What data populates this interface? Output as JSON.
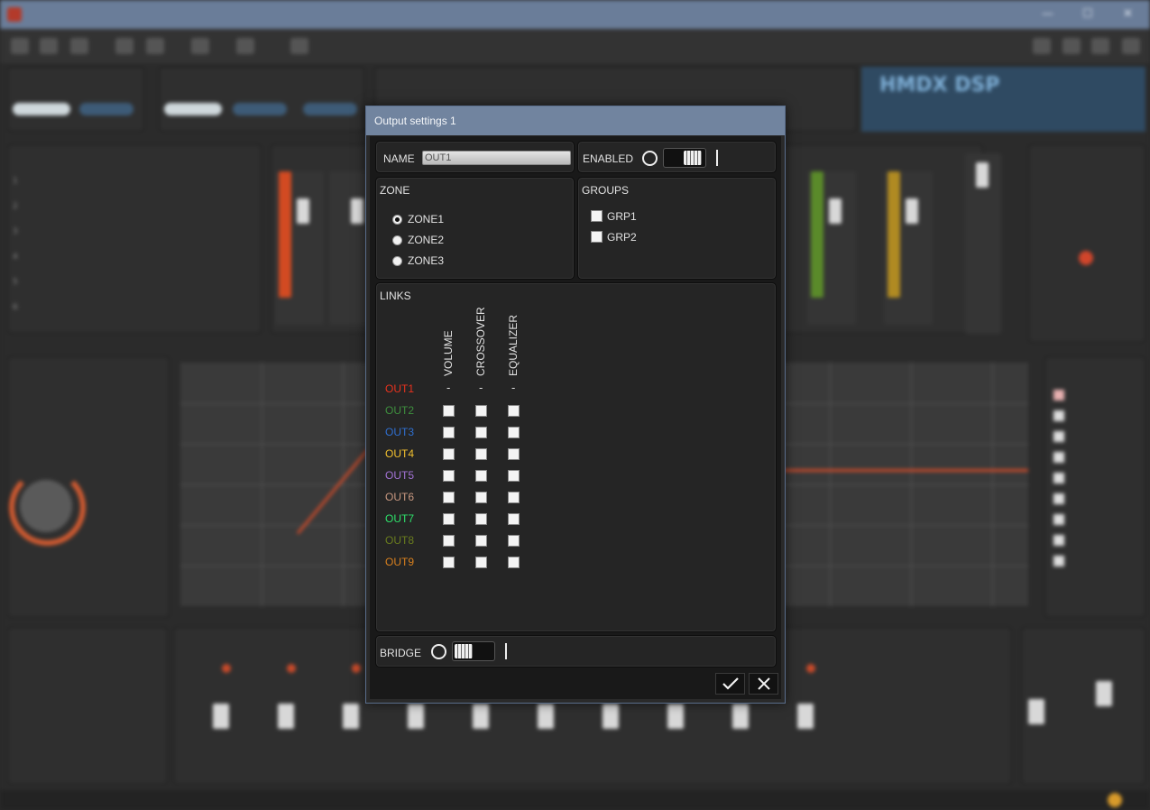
{
  "dialog": {
    "title": "Output settings 1",
    "name_label": "NAME",
    "name_value": "OUT1",
    "enabled_label": "ENABLED",
    "zone_label": "ZONE",
    "zones": [
      "ZONE1",
      "ZONE2",
      "ZONE3"
    ],
    "selected_zone": "ZONE1",
    "groups_label": "GROUPS",
    "groups": [
      "GRP1",
      "GRP2"
    ],
    "links_label": "LINKS",
    "link_columns": [
      "VOLUME",
      "CROSSOVER",
      "EQUALIZER"
    ],
    "outputs": [
      {
        "label": "OUT1",
        "color": "#e8321e",
        "current": true
      },
      {
        "label": "OUT2",
        "color": "#3e8f3e"
      },
      {
        "label": "OUT3",
        "color": "#2f6fd0"
      },
      {
        "label": "OUT4",
        "color": "#f2c02e"
      },
      {
        "label": "OUT5",
        "color": "#a373d6"
      },
      {
        "label": "OUT6",
        "color": "#c89880"
      },
      {
        "label": "OUT7",
        "color": "#2ee06a"
      },
      {
        "label": "OUT8",
        "color": "#6a7d1e"
      },
      {
        "label": "OUT9",
        "color": "#d8801e"
      }
    ],
    "current_marker": "-",
    "bridge_label": "BRIDGE",
    "ok_icon": "checkmark-icon",
    "cancel_icon": "close-icon"
  },
  "background": {
    "logo_text": "HMDX DSP"
  }
}
